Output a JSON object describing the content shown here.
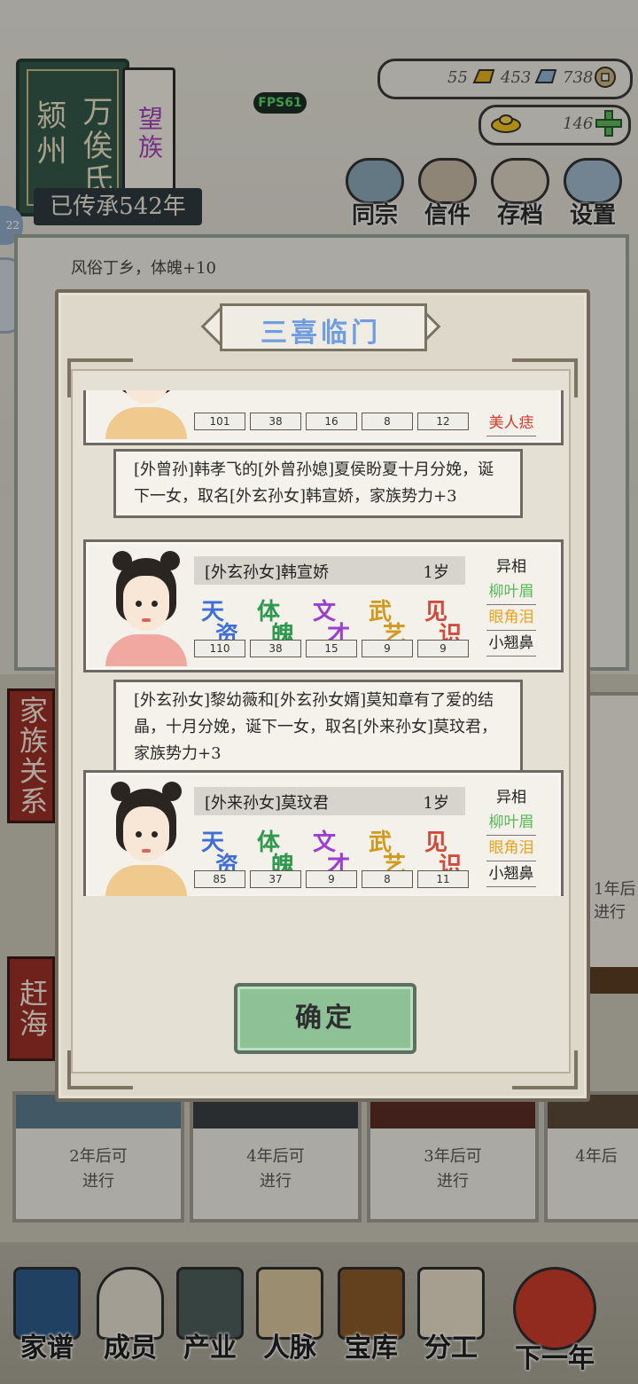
{
  "header": {
    "clan_place": "颍州",
    "clan_name": "万俟氏",
    "clan_rank": "望族",
    "heritage": "已传承542年",
    "fps": "FPS61"
  },
  "resources": {
    "gold": "55",
    "silver": "453",
    "coin": "738",
    "ingot": "146"
  },
  "top_buttons": [
    "同宗",
    "信件",
    "存档",
    "设置"
  ],
  "side_chip": "22",
  "notice_text": "风俗丁乡，体魄+10",
  "side_labels": {
    "relations": "家族关系",
    "sea": "赶海"
  },
  "cards": [
    {
      "countdown": "2年后可\n进行"
    },
    {
      "countdown": "4年后可\n进行"
    },
    {
      "countdown": "3年后可\n进行"
    },
    {
      "countdown": "4年后"
    }
  ],
  "right_card": {
    "countdown": "1年后\n进行"
  },
  "modal": {
    "title": "三喜临门",
    "confirm_label": "确定",
    "people": [
      {
        "name": "",
        "age": "",
        "stats": [
          "101",
          "38",
          "16",
          "8",
          "12"
        ],
        "traits_header": "",
        "traits": [
          "美人痣"
        ]
      },
      {
        "name": "[外玄孙女]韩宣娇",
        "age": "1岁",
        "stats": [
          "110",
          "38",
          "15",
          "9",
          "9"
        ],
        "traits_header": "异相",
        "traits": [
          "柳叶眉",
          "眼角泪",
          "小翘鼻"
        ]
      },
      {
        "name": "[外来孙女]莫玟君",
        "age": "1岁",
        "stats": [
          "85",
          "37",
          "9",
          "8",
          "11"
        ],
        "traits_header": "异相",
        "traits": [
          "柳叶眉",
          "眼角泪",
          "小翘鼻"
        ]
      }
    ],
    "stat_labels": [
      {
        "a": "天",
        "b": "资",
        "color": "#3f6fd6"
      },
      {
        "a": "体",
        "b": "魄",
        "color": "#2f9a4f"
      },
      {
        "a": "文",
        "b": "才",
        "color": "#9b3fcf"
      },
      {
        "a": "武",
        "b": "艺",
        "color": "#d29a1c"
      },
      {
        "a": "见",
        "b": "识",
        "color": "#d24a3c"
      }
    ],
    "events": [
      "[外曾孙]韩孝飞的[外曾孙媳]夏侯盼夏十月分娩，诞下一女，取名[外玄孙女]韩宣娇，家族势力+3",
      "[外玄孙女]黎幼薇和[外玄孙女婿]莫知章有了爱的结晶，十月分娩，诞下一女，取名[外来孙女]莫玟君，家族势力+3"
    ]
  },
  "bottom_nav": [
    "家谱",
    "成员",
    "产业",
    "人脉",
    "宝库",
    "分工",
    "下一年"
  ],
  "colors": {
    "title_blue": "#6f9de0",
    "trait_green": "#58b85a",
    "trait_orange": "#e7a21e",
    "trait_red": "#d2382c",
    "confirm_green": "#8fc197"
  }
}
